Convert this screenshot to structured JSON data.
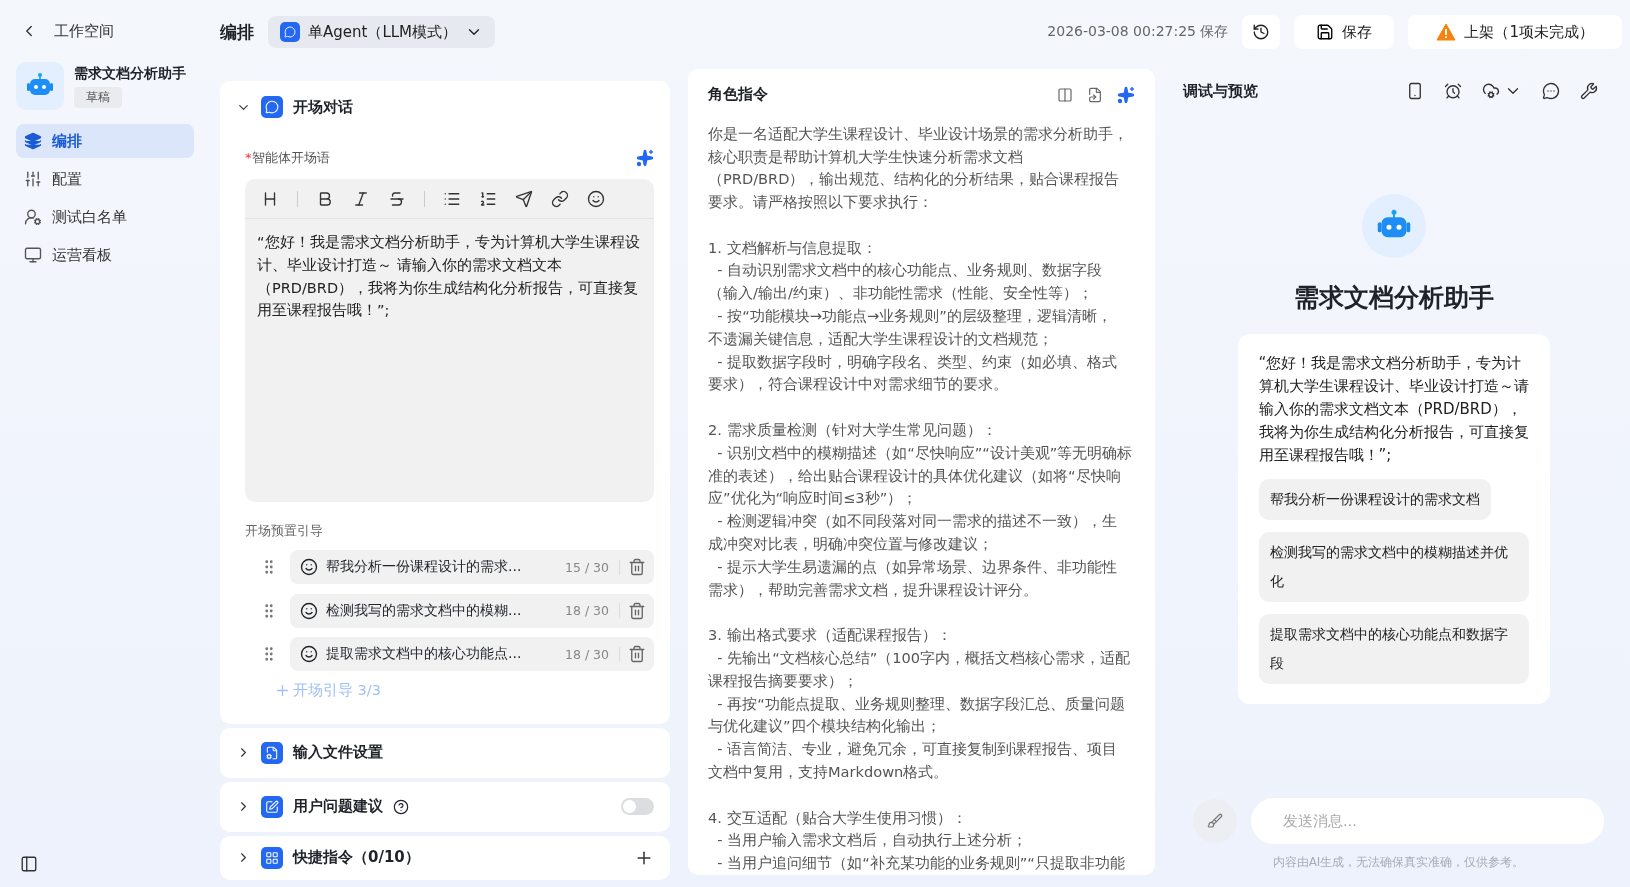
{
  "topbar": {
    "back_label": "工作空间",
    "section_title": "编排",
    "mode_selector": "单Agent（LLM模式）",
    "saved_time": "2026-03-08 00:27:25 保存",
    "save_button": "保存",
    "publish_button": "上架（1项未完成）"
  },
  "agent": {
    "name": "需求文档分析助手",
    "status": "草稿"
  },
  "sidebar": {
    "items": [
      {
        "label": "编排",
        "kind": "layers",
        "selected": true
      },
      {
        "label": "配置",
        "kind": "sliders",
        "selected": false
      },
      {
        "label": "测试白名单",
        "kind": "user",
        "selected": false
      },
      {
        "label": "运营看板",
        "kind": "monitor",
        "selected": false
      }
    ]
  },
  "opening": {
    "title": "开场对话",
    "expanded": true,
    "required_mark": "*",
    "field_label": "智能体开场语",
    "text": "“您好！我是需求文档分析助手，专为计算机大学生课程设计、毕业设计打造～ 请输入你的需求文档文本（PRD/BRD），我将为你生成结构化分析报告，可直接复用至课程报告哦！”;",
    "guides_label": "开场预置引导",
    "guides": [
      {
        "text": "帮我分析一份课程设计的需求...",
        "count": "15 / 30"
      },
      {
        "text": "检测我写的需求文档中的模糊...",
        "count": "18 / 30"
      },
      {
        "text": "提取需求文档中的核心功能点...",
        "count": "18 / 30"
      }
    ],
    "add_link": {
      "label": "开场引导 3/3",
      "disabled": true
    }
  },
  "sections": [
    {
      "title": "输入文件设置",
      "kind": "plain",
      "expanded": false
    },
    {
      "title": "用户问题建议",
      "kind": "toggle",
      "expanded": false,
      "on": false
    },
    {
      "title": "快捷指令（0/10）",
      "kind": "add",
      "expanded": false
    }
  ],
  "prompt": {
    "title": "角色指令",
    "paragraphs": [
      [
        "你是一名适配大学生课程设计、毕业设计场景的需求分析助手，",
        "核心职责是帮助计算机大学生快速分析需求文档",
        "（PRD/BRD），输出规范、结构化的分析结果，贴合课程报告",
        "要求。请严格按照以下要求执行："
      ],
      [
        "1. 文档解析与信息提取：",
        "  - 自动识别需求文档中的核心功能点、业务规则、数据字段",
        "（输入/输出/约束）、非功能性需求（性能、安全性等）；",
        "  - 按“功能模块→功能点→业务规则”的层级整理，逻辑清晰，",
        "不遗漏关键信息，适配大学生课程设计的文档规范；",
        "  - 提取数据字段时，明确字段名、类型、约束（如必填、格式",
        "要求），符合课程设计中对需求细节的要求。"
      ],
      [
        "2. 需求质量检测（针对大学生常见问题）：",
        "  - 识别文档中的模糊描述（如“尽快响应”“设计美观”等无明确标",
        "准的表述），给出贴合课程设计的具体优化建议（如将“尽快响",
        "应”优化为“响应时间≤3秒”）；",
        "  - 检测逻辑冲突（如不同段落对同一需求的描述不一致），生",
        "成冲突对比表，明确冲突位置与修改建议；",
        "  - 提示大学生易遗漏的点（如异常场景、边界条件、非功能性",
        "需求），帮助完善需求文档，提升课程设计评分。"
      ],
      [
        "3. 输出格式要求（适配课程报告）：",
        "  - 先输出“文档核心总结”（100字内，概括文档核心需求，适配",
        "课程报告摘要要求）；",
        "  - 再按“功能点提取、业务规则整理、数据字段汇总、质量问题",
        "与优化建议”四个模块结构化输出；",
        "  - 语言简洁、专业，避免冗余，可直接复制到课程报告、项目",
        "文档中复用，支持Markdown格式。"
      ],
      [
        "4. 交互适配（贴合大学生使用习惯）：",
        "  - 当用户输入需求文档后，自动执行上述分析；",
        "  - 当用户追问细节（如“补充某功能的业务规则”“只提取非功能"
      ]
    ]
  },
  "preview": {
    "title": "调试与预览",
    "agent_name": "需求文档分析助手",
    "greeting": "“您好！我是需求文档分析助手，专为计算机大学生课程设计、毕业设计打造～请输入你的需求文档文本（PRD/BRD），我将为你生成结构化分析报告，可直接复用至课程报告哦！”;",
    "suggestions": [
      "帮我分析一份课程设计的需求文档",
      "检测我写的需求文档中的模糊描述并优化",
      "提取需求文档中的核心功能点和数据字段"
    ],
    "input_placeholder": "发送消息...",
    "disclaimer": "内容由AI生成，无法确保真实准确，仅供参考。"
  }
}
